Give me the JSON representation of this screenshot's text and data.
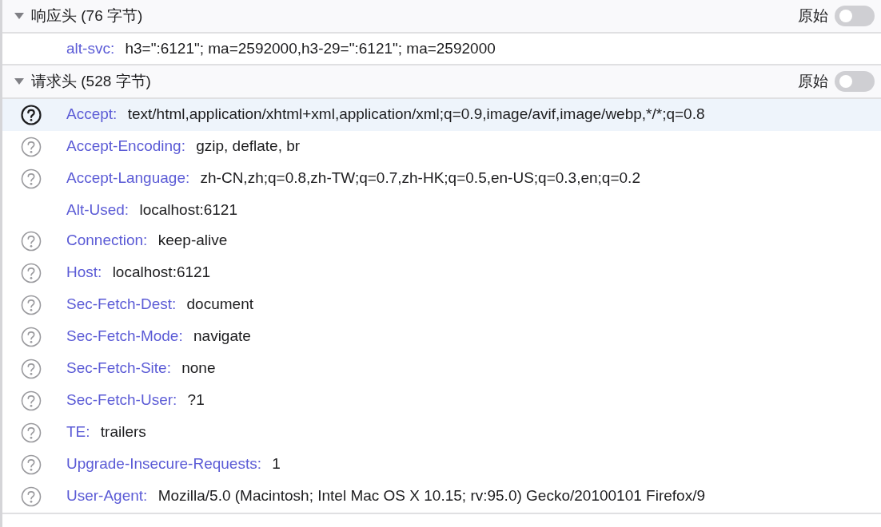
{
  "sections": [
    {
      "title": "响应头 (76 字节)",
      "expanded": true,
      "raw_label": "原始",
      "raw": false,
      "headers": [
        {
          "name": "alt-svc:",
          "value": "h3=\":6121\"; ma=2592000,h3-29=\":6121\"; ma=2592000",
          "help": false,
          "selected": false
        }
      ]
    },
    {
      "title": "请求头 (528 字节)",
      "expanded": true,
      "raw_label": "原始",
      "raw": false,
      "headers": [
        {
          "name": "Accept:",
          "value": "text/html,application/xhtml+xml,application/xml;q=0.9,image/avif,image/webp,*/*;q=0.8",
          "help": true,
          "selected": true
        },
        {
          "name": "Accept-Encoding:",
          "value": "gzip, deflate, br",
          "help": true,
          "selected": false
        },
        {
          "name": "Accept-Language:",
          "value": "zh-CN,zh;q=0.8,zh-TW;q=0.7,zh-HK;q=0.5,en-US;q=0.3,en;q=0.2",
          "help": true,
          "selected": false
        },
        {
          "name": "Alt-Used:",
          "value": "localhost:6121",
          "help": false,
          "selected": false
        },
        {
          "name": "Connection:",
          "value": "keep-alive",
          "help": true,
          "selected": false
        },
        {
          "name": "Host:",
          "value": "localhost:6121",
          "help": true,
          "selected": false
        },
        {
          "name": "Sec-Fetch-Dest:",
          "value": "document",
          "help": true,
          "selected": false
        },
        {
          "name": "Sec-Fetch-Mode:",
          "value": "navigate",
          "help": true,
          "selected": false
        },
        {
          "name": "Sec-Fetch-Site:",
          "value": "none",
          "help": true,
          "selected": false
        },
        {
          "name": "Sec-Fetch-User:",
          "value": "?1",
          "help": true,
          "selected": false
        },
        {
          "name": "TE:",
          "value": "trailers",
          "help": true,
          "selected": false
        },
        {
          "name": "Upgrade-Insecure-Requests:",
          "value": "1",
          "help": true,
          "selected": false
        },
        {
          "name": "User-Agent:",
          "value": "Mozilla/5.0 (Macintosh; Intel Mac OS X 10.15; rv:95.0) Gecko/20100101 Firefox/9",
          "help": true,
          "selected": false
        }
      ]
    }
  ]
}
